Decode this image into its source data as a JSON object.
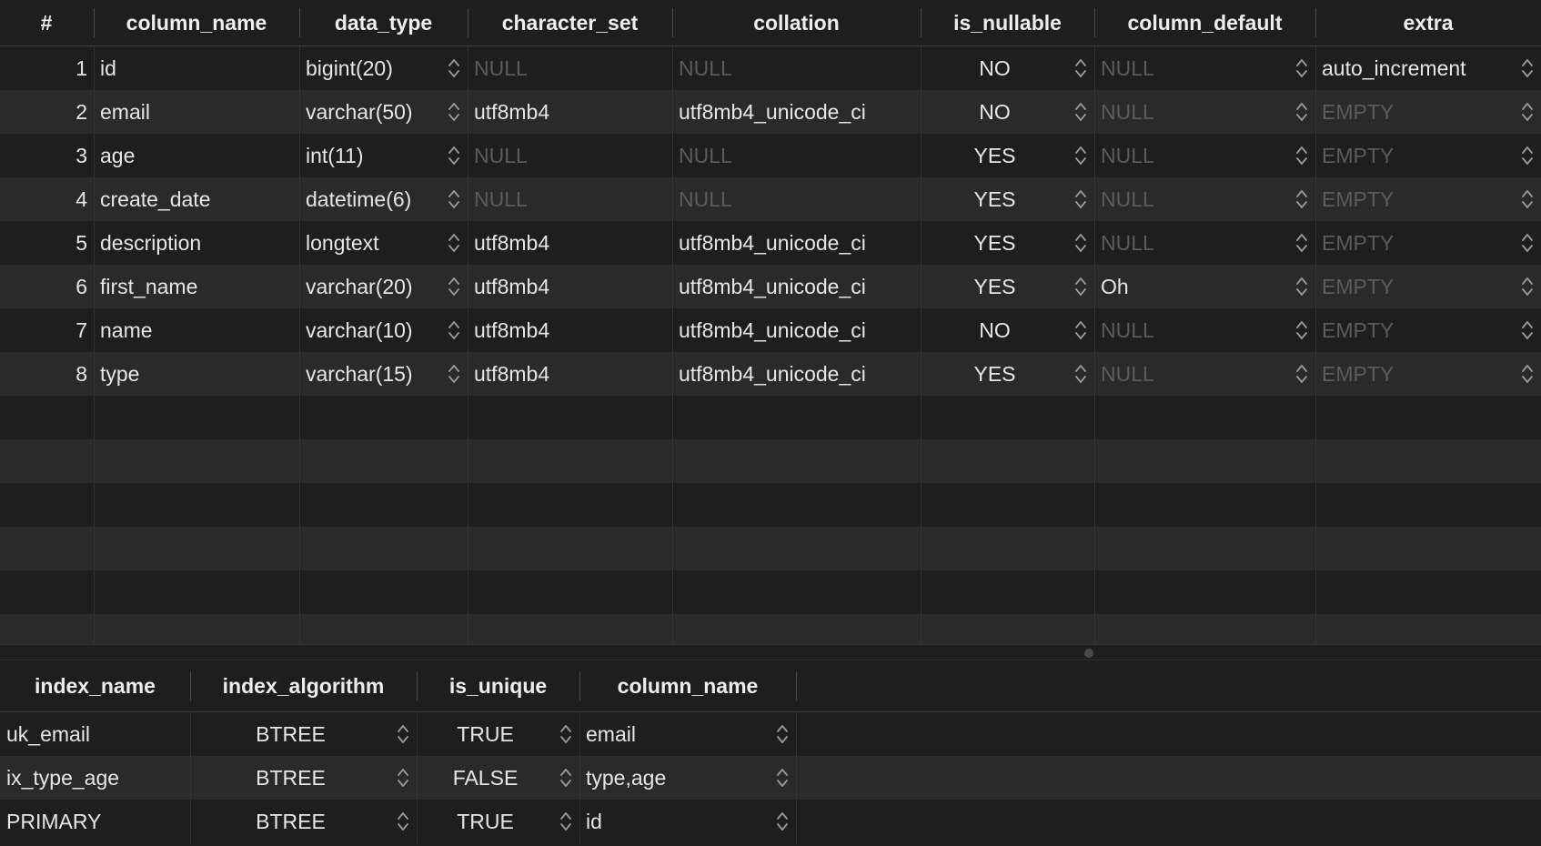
{
  "columns_table": {
    "headers": [
      "#",
      "column_name",
      "data_type",
      "character_set",
      "collation",
      "is_nullable",
      "column_default",
      "extra"
    ],
    "rows": [
      {
        "n": "1",
        "column_name": "id",
        "data_type": "bigint(20)",
        "character_set": "NULL",
        "collation": "NULL",
        "is_nullable": "NO",
        "column_default": "NULL",
        "extra": "auto_increment"
      },
      {
        "n": "2",
        "column_name": "email",
        "data_type": "varchar(50)",
        "character_set": "utf8mb4",
        "collation": "utf8mb4_unicode_ci",
        "is_nullable": "NO",
        "column_default": "NULL",
        "extra": "EMPTY"
      },
      {
        "n": "3",
        "column_name": "age",
        "data_type": "int(11)",
        "character_set": "NULL",
        "collation": "NULL",
        "is_nullable": "YES",
        "column_default": "NULL",
        "extra": "EMPTY"
      },
      {
        "n": "4",
        "column_name": "create_date",
        "data_type": "datetime(6)",
        "character_set": "NULL",
        "collation": "NULL",
        "is_nullable": "YES",
        "column_default": "NULL",
        "extra": "EMPTY"
      },
      {
        "n": "5",
        "column_name": "description",
        "data_type": "longtext",
        "character_set": "utf8mb4",
        "collation": "utf8mb4_unicode_ci",
        "is_nullable": "YES",
        "column_default": "NULL",
        "extra": "EMPTY"
      },
      {
        "n": "6",
        "column_name": "first_name",
        "data_type": "varchar(20)",
        "character_set": "utf8mb4",
        "collation": "utf8mb4_unicode_ci",
        "is_nullable": "YES",
        "column_default": "Oh",
        "extra": "EMPTY"
      },
      {
        "n": "7",
        "column_name": "name",
        "data_type": "varchar(10)",
        "character_set": "utf8mb4",
        "collation": "utf8mb4_unicode_ci",
        "is_nullable": "NO",
        "column_default": "NULL",
        "extra": "EMPTY"
      },
      {
        "n": "8",
        "column_name": "type",
        "data_type": "varchar(15)",
        "character_set": "utf8mb4",
        "collation": "utf8mb4_unicode_ci",
        "is_nullable": "YES",
        "column_default": "NULL",
        "extra": "EMPTY"
      }
    ]
  },
  "index_table": {
    "headers": [
      "index_name",
      "index_algorithm",
      "is_unique",
      "column_name"
    ],
    "rows": [
      {
        "index_name": "uk_email",
        "index_algorithm": "BTREE",
        "is_unique": "TRUE",
        "column_name": "email"
      },
      {
        "index_name": "ix_type_age",
        "index_algorithm": "BTREE",
        "is_unique": "FALSE",
        "column_name": "type,age"
      },
      {
        "index_name": "PRIMARY",
        "index_algorithm": "BTREE",
        "is_unique": "TRUE",
        "column_name": "id"
      }
    ]
  },
  "colors": {
    "background": "#1e1e1e",
    "row_alt": "#2a2a2a",
    "text": "#e6e6e6",
    "muted_placeholder": "#5c5c5c"
  },
  "placeholder_values": [
    "NULL",
    "EMPTY"
  ],
  "icons": {
    "stepper": "chevron-up-down-icon",
    "splitter": "drag-handle-icon"
  }
}
